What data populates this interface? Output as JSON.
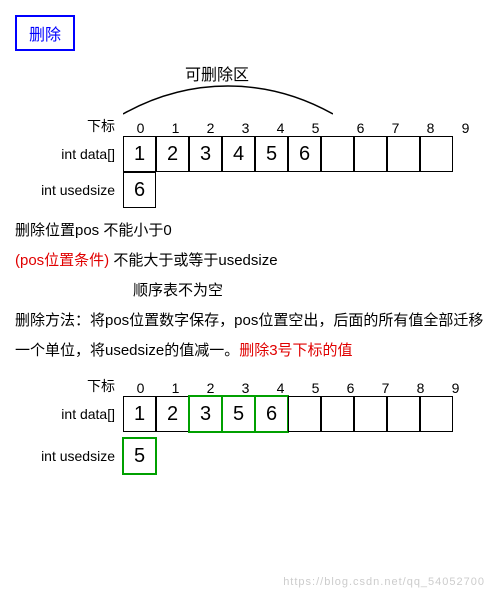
{
  "title": "删除",
  "region_label": "可删除区",
  "labels": {
    "index": "下标",
    "data": "int data[]",
    "usedsize": "int usedsize"
  },
  "indices": [
    "0",
    "1",
    "2",
    "3",
    "4",
    "5",
    "6",
    "7",
    "8",
    "9"
  ],
  "before": {
    "data": [
      "1",
      "2",
      "3",
      "4",
      "5",
      "6",
      "",
      "",
      "",
      ""
    ],
    "usedsize": "6"
  },
  "rules": {
    "line1": "删除位置pos  不能小于0",
    "cond_label": "(pos位置条件)",
    "line2b": "不能大于或等于usedsize",
    "line3": "顺序表不为空",
    "method": "删除方法：将pos位置数字保存，pos位置空出，后面的所有值全部迁移一个单位，将usedsize的值减一。",
    "red_note": "删除3号下标的值"
  },
  "after": {
    "data": [
      "1",
      "2",
      "3",
      "5",
      "6",
      "",
      "",
      "",
      "",
      ""
    ],
    "usedsize": "5",
    "green_cells": [
      2,
      3,
      4
    ],
    "green_usedsize": true
  },
  "watermark": "https://blog.csdn.net/qq_54052700"
}
